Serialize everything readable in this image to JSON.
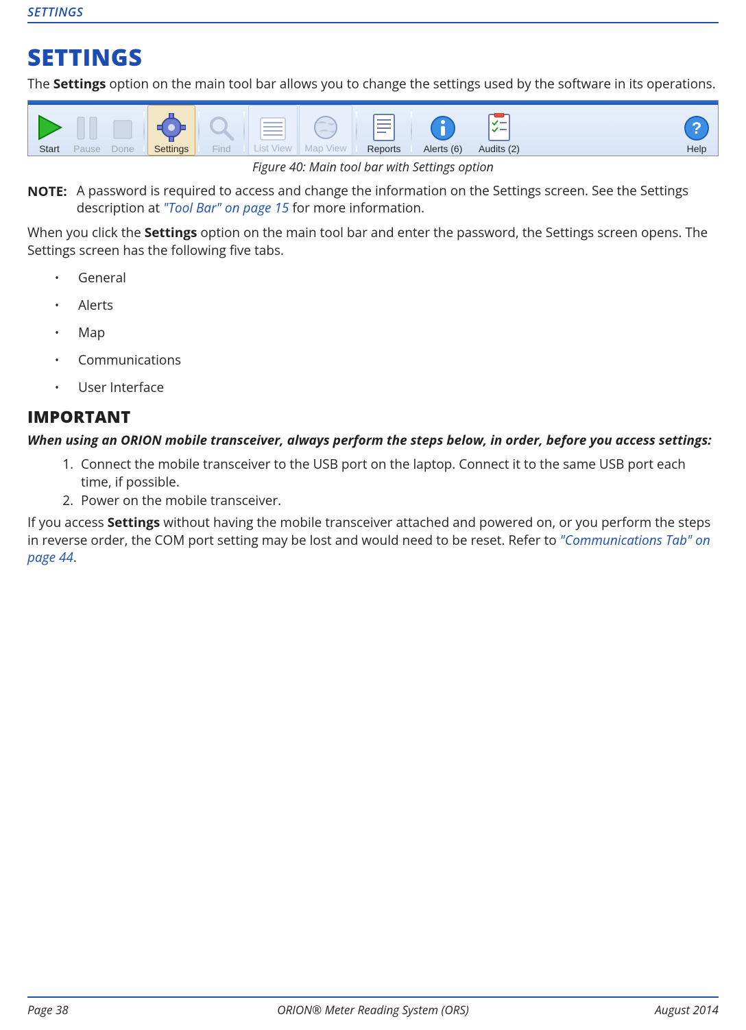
{
  "header": {
    "running_title": "SETTINGS"
  },
  "title": "SETTINGS",
  "intro": {
    "pre": "The ",
    "bold": "Settings",
    "post": " option on the main tool bar allows you to change the settings used by the software in its operations."
  },
  "toolbar": {
    "start": "Start",
    "pause": "Pause",
    "done": "Done",
    "settings": "Settings",
    "find": "Find",
    "list_view": "List View",
    "map_view": "Map View",
    "reports": "Reports",
    "alerts": "Alerts (6)",
    "audits": "Audits (2)",
    "help": "Help"
  },
  "figure_caption": "Figure 40:  Main tool bar with Settings option",
  "note": {
    "label": "NOTE:",
    "text_pre": "A password is required to access and change the information on the Settings screen. See the Settings description at ",
    "link": "\"Tool Bar\" on page 15",
    "text_post": " for more information."
  },
  "after_note": {
    "pre": "When you click the ",
    "bold": "Settings",
    "post": " option on the main tool bar and enter the password, the Settings screen opens. The Settings screen has the following five tabs."
  },
  "tabs": [
    "General",
    "Alerts",
    "Map",
    "Communications",
    "User Interface"
  ],
  "important": {
    "heading": "IMPORTANT",
    "lead": "When using an ORION mobile transceiver, always perform the steps below, in order, before you access settings:",
    "steps": [
      "Connect the mobile transceiver to the USB port on the laptop. Connect it to the same USB port each time, if possible.",
      "Power on the mobile transceiver."
    ],
    "tail_pre": "If you access ",
    "tail_bold": "Settings",
    "tail_mid": " without having the mobile transceiver attached and powered on, or you perform the steps in reverse order, the COM port setting may be lost and would need to be reset. Refer to ",
    "tail_link": "\"Communications Tab\" on page 44",
    "tail_post": "."
  },
  "footer": {
    "left": "Page 38",
    "center": "ORION® Meter Reading System (ORS)",
    "right": "August  2014"
  }
}
